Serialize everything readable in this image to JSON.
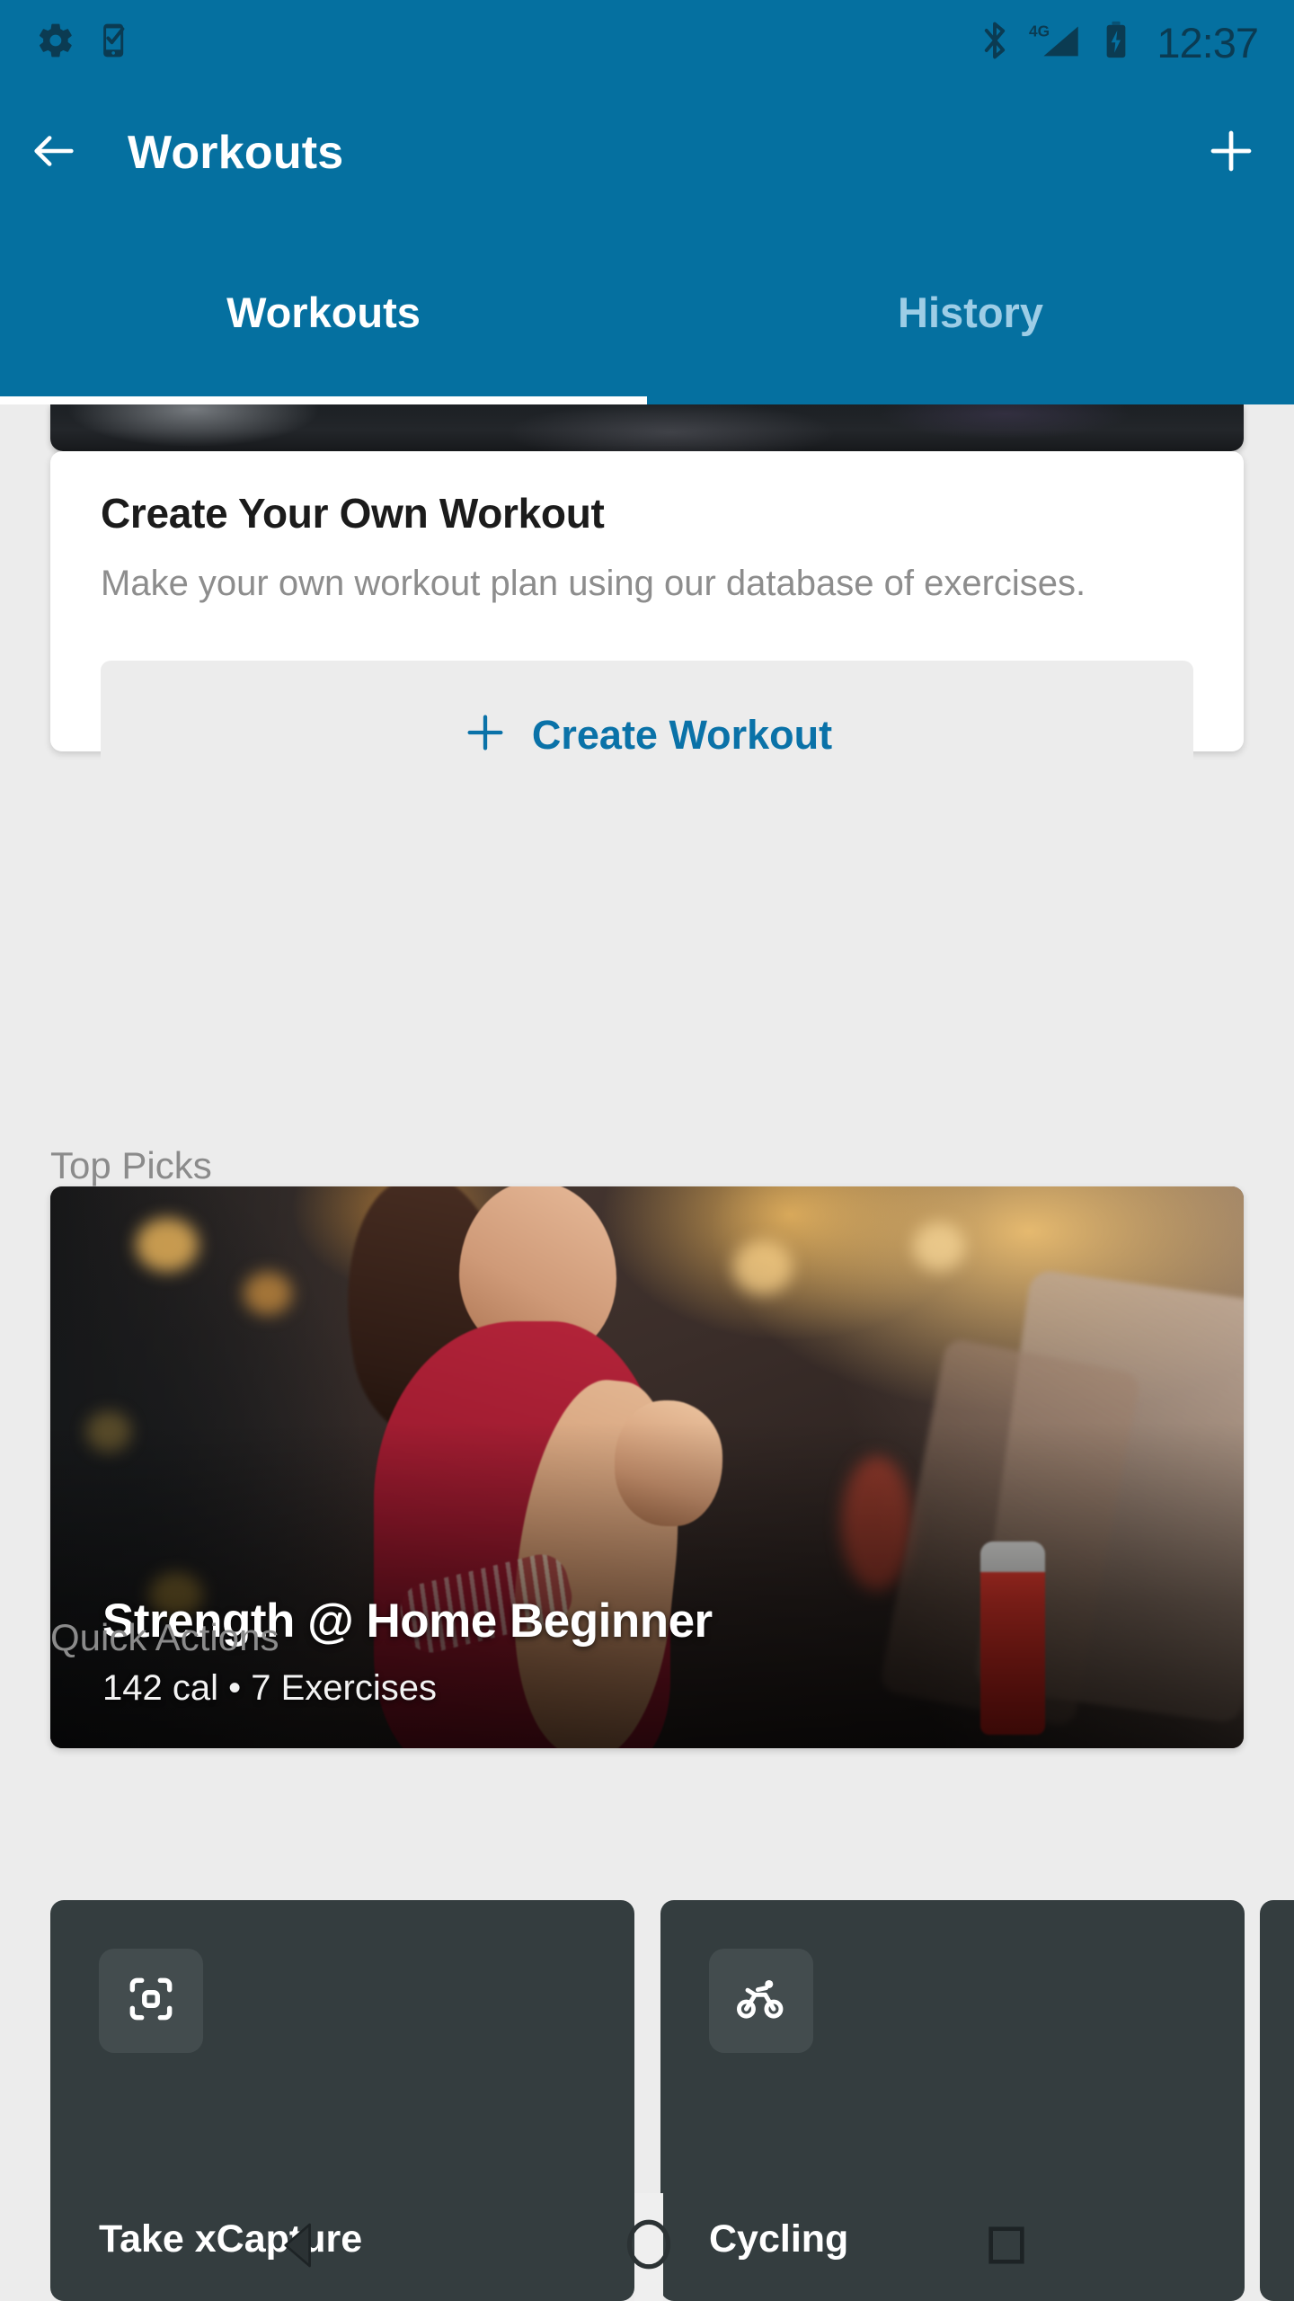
{
  "status_bar": {
    "time": "12:37",
    "left_icons": [
      "gear-icon",
      "phone-check-icon"
    ],
    "right_icons": [
      "bluetooth-icon",
      "signal-4g-icon",
      "battery-charging-icon"
    ],
    "network_label": "4G",
    "background_color": "#0570a0",
    "icon_color": "#0b3b52"
  },
  "app_bar": {
    "title": "Workouts",
    "back_label": "back-arrow-icon",
    "add_label": "plus-icon",
    "background_color": "#0570a0"
  },
  "tabs": {
    "items": [
      {
        "label": "Workouts",
        "active": true
      },
      {
        "label": "History",
        "active": false
      }
    ],
    "active_color": "#ffffff",
    "inactive_color": "#9dcde6"
  },
  "create_card": {
    "title": "Create Your Own Workout",
    "subtitle": "Make your own workout plan using our database of exercises.",
    "button_label": "Create Workout",
    "button_icon": "plus-icon",
    "button_text_color": "#0a72a8",
    "button_bg_color": "#ececec"
  },
  "sections": {
    "top_picks_heading": "Top Picks",
    "quick_actions_heading": "Quick Actions"
  },
  "featured_workout": {
    "title": "Strength @ Home Beginner",
    "meta": "142 cal • 7 Exercises",
    "calories": "142 cal",
    "exercise_count": "7 Exercises"
  },
  "quick_actions": [
    {
      "label": "Take xCapture",
      "icon": "scan-frame-icon"
    },
    {
      "label": "Cycling",
      "icon": "cyclist-icon"
    },
    {
      "label": "",
      "icon": ""
    }
  ],
  "navigation_bar": {
    "back": "nav-back-triangle-icon",
    "home": "nav-home-circle-icon",
    "recents": "nav-recents-square-icon"
  }
}
